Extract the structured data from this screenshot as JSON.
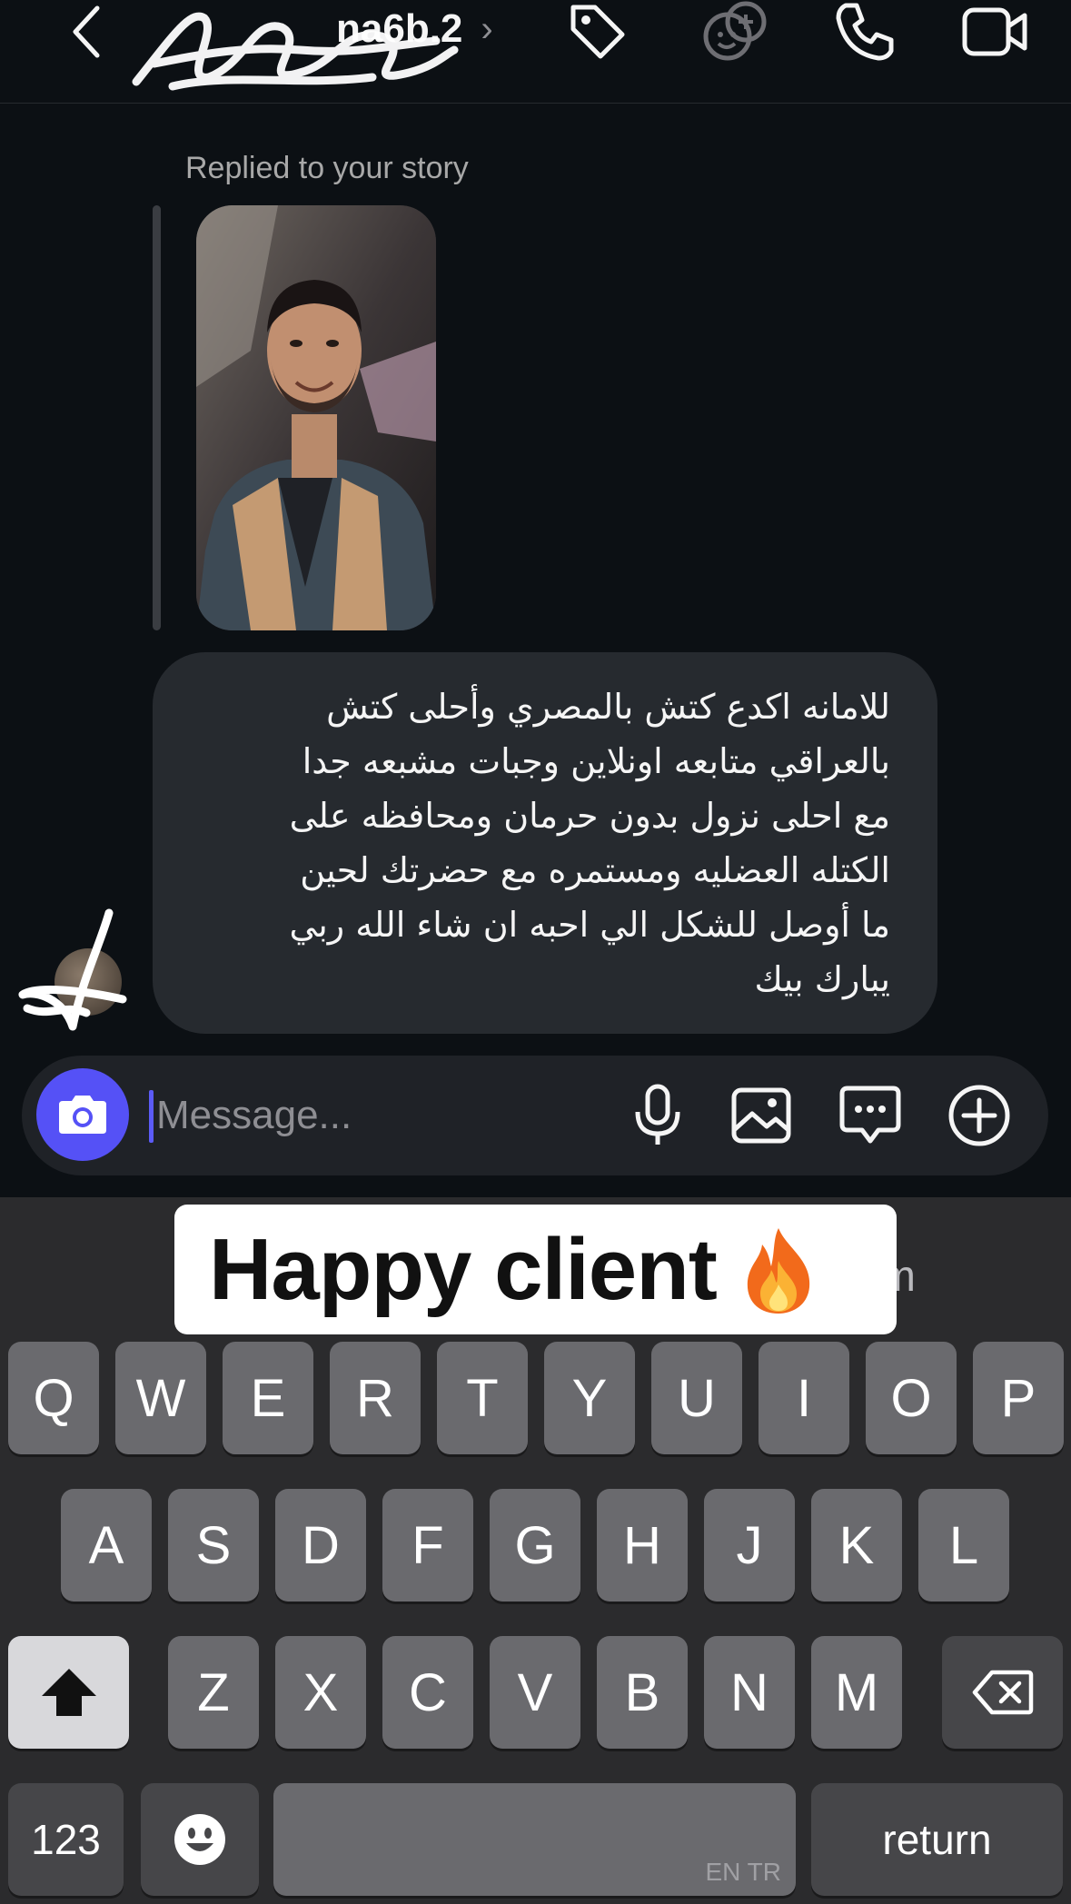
{
  "header": {
    "username": "na6b.2",
    "icons": [
      "back-chevron-icon",
      "tag-icon",
      "game-controller-icon",
      "phone-icon",
      "video-camera-icon"
    ]
  },
  "chat": {
    "replied_label": "Replied to your story",
    "message_lines": [
      "للامانه اكدع كتش بالمصري وأحلى كتش",
      "بالعراقي متابعه اونلاين وجبات مشبعه جدا",
      "مع احلى نزول بدون حرمان ومحافظه على",
      "الكتله العضليه ومستمره مع حضرتك لحين",
      "ما أوصل للشكل الي احبه ان شاء الله ربي",
      "يبارك بيك"
    ]
  },
  "composer": {
    "placeholder": "Message...",
    "value": ""
  },
  "overlay": {
    "banner_text": "Happy client",
    "suggestion_tail": "m"
  },
  "keyboard": {
    "row1": [
      "Q",
      "W",
      "E",
      "R",
      "T",
      "Y",
      "U",
      "I",
      "O",
      "P"
    ],
    "row2": [
      "A",
      "S",
      "D",
      "F",
      "G",
      "H",
      "J",
      "K",
      "L"
    ],
    "row3": [
      "Z",
      "X",
      "C",
      "V",
      "B",
      "N",
      "M"
    ],
    "numbers_label": "123",
    "return_label": "return",
    "space_lang": "EN TR"
  },
  "colors": {
    "background": "#0c1014",
    "bubble": "#262a2f",
    "accent": "#5551f6",
    "keyboard": "#2b2b2d",
    "key": "#6a6a6e"
  }
}
